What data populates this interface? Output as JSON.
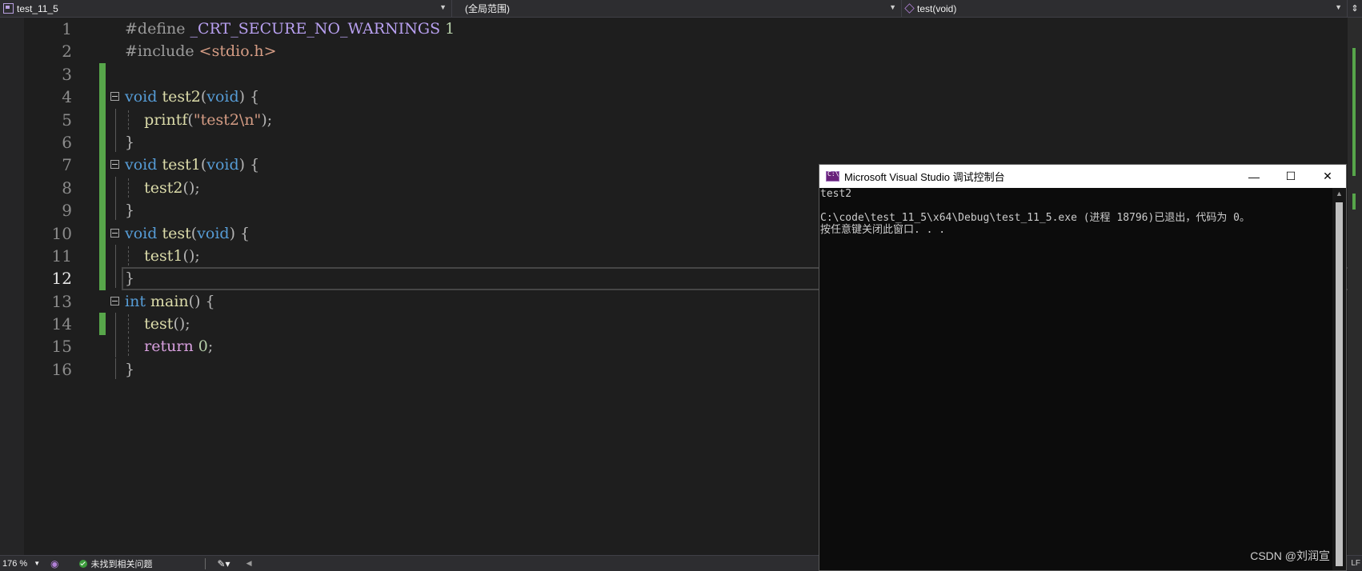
{
  "navbar": {
    "project": "test_11_5",
    "scope": "(全局范围)",
    "function": "test(void)"
  },
  "line_numbers": [
    "1",
    "2",
    "3",
    "4",
    "5",
    "6",
    "7",
    "8",
    "9",
    "10",
    "11",
    "12",
    "13",
    "14",
    "15",
    "16"
  ],
  "active_line": "12",
  "code": {
    "l1": {
      "kw": "#define",
      "macro": "_CRT_SECURE_NO_WARNINGS",
      "num": "1"
    },
    "l2": {
      "kw": "#include",
      "str": "<stdio.h>"
    },
    "l4": {
      "type": "void",
      "name": "test2",
      "open": "(",
      "param": "void",
      "close": ")",
      "brace": " {"
    },
    "l5": {
      "fn": "printf",
      "open": "(",
      "str": "\"test2\\n\"",
      "close": ");"
    },
    "l6": {
      "brace": "}"
    },
    "l7": {
      "type": "void",
      "name": "test1",
      "open": "(",
      "param": "void",
      "close": ")",
      "brace": " {"
    },
    "l8": {
      "fn": "test2",
      "call": "();"
    },
    "l9": {
      "brace": "}"
    },
    "l10": {
      "type": "void",
      "name": "test",
      "open": "(",
      "param": "void",
      "close": ")",
      "brace": " {"
    },
    "l11": {
      "fn": "test1",
      "call": "();"
    },
    "l12": {
      "brace": "}"
    },
    "l13": {
      "type": "int",
      "name": "main",
      "paren": "()",
      "brace": " {"
    },
    "l14": {
      "fn": "test",
      "call": "();"
    },
    "l15": {
      "kw": "return",
      "num": "0",
      "end": ";"
    },
    "l16": {
      "brace": "}"
    }
  },
  "status": {
    "zoom": "176 %",
    "issues": "未找到相关问题",
    "line_ending": "LF"
  },
  "console": {
    "title": "Microsoft Visual Studio 调试控制台",
    "minimize": "—",
    "maximize": "☐",
    "close": "✕",
    "output": [
      "test2",
      "",
      "C:\\code\\test_11_5\\x64\\Debug\\test_11_5.exe (进程 18796)已退出，代码为 0。",
      "按任意键关闭此窗口. . ."
    ]
  },
  "watermark": "CSDN @刘润宣",
  "colors": {
    "editor_bg": "#1e1e1e",
    "keyword": "#569cd6",
    "change_bar": "#57a64a",
    "console_bg": "#0c0c0c"
  }
}
